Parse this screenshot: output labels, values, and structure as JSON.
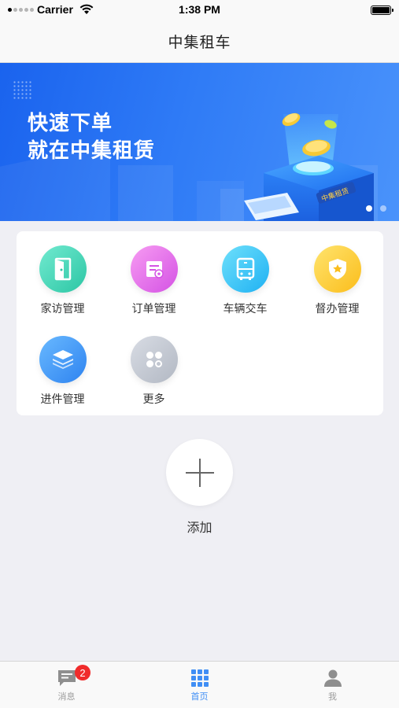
{
  "status_bar": {
    "carrier": "Carrier",
    "time": "1:38 PM"
  },
  "nav": {
    "title": "中集租车"
  },
  "banner": {
    "line1": "快速下单",
    "line2": "就在中集租赁",
    "sign_text": "中集租赁",
    "pages": 2,
    "active_page": 1
  },
  "menu": {
    "items": [
      {
        "label": "家访管理",
        "icon": "door-icon",
        "color": "#2cc6a4"
      },
      {
        "label": "订单管理",
        "icon": "order-icon",
        "color": "#d452e4"
      },
      {
        "label": "车辆交车",
        "icon": "bus-icon",
        "color": "#1fb1f3"
      },
      {
        "label": "督办管理",
        "icon": "shield-star-icon",
        "color": "#fbbd1b"
      },
      {
        "label": "进件管理",
        "icon": "documents-icon",
        "color": "#2e83f0"
      },
      {
        "label": "更多",
        "icon": "more-icon",
        "color": "#b2b8c3"
      }
    ]
  },
  "add": {
    "label": "添加"
  },
  "tabbar": {
    "tabs": [
      {
        "label": "消息",
        "icon": "message-icon",
        "badge": "2"
      },
      {
        "label": "首页",
        "icon": "grid-icon",
        "active": true
      },
      {
        "label": "我",
        "icon": "person-icon"
      }
    ],
    "active_color": "#3f8ef5"
  }
}
